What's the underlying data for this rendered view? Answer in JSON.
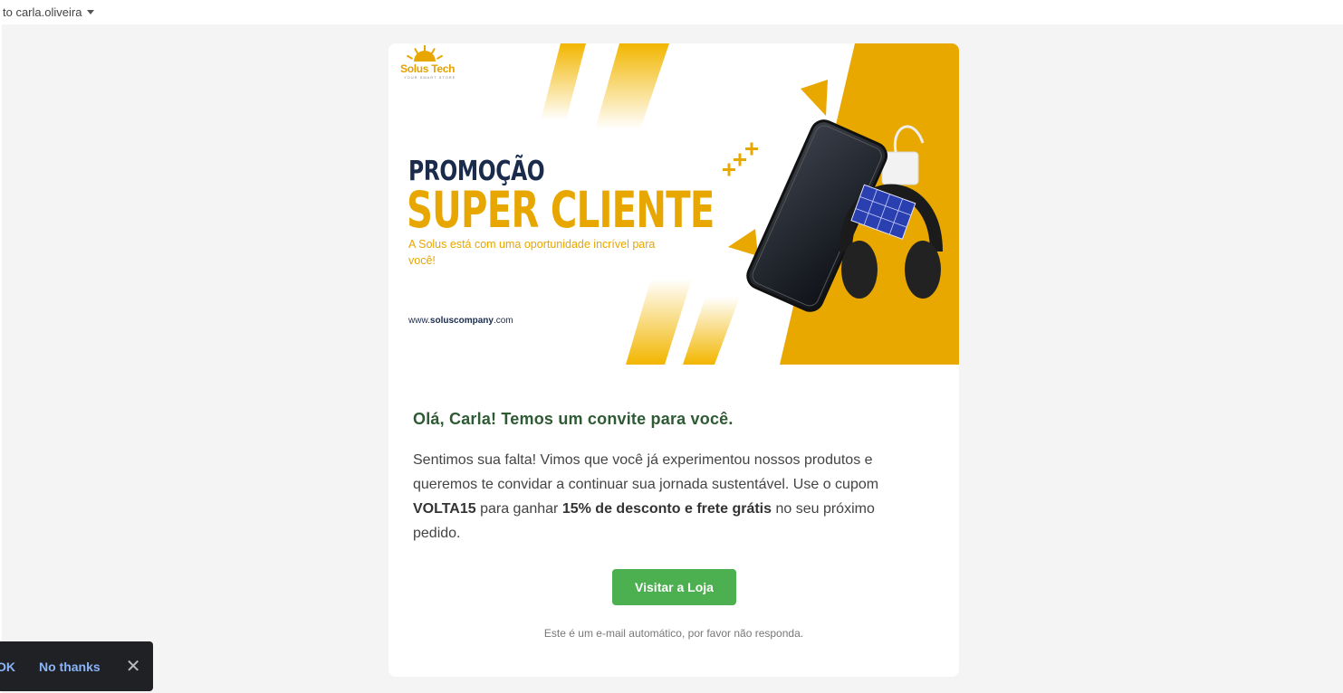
{
  "header": {
    "recipient_label": "to carla.oliveira"
  },
  "banner": {
    "logo_text": "Solus Tech",
    "logo_sub": "YOUR SMART STORE",
    "headline_1": "PROMOÇÃO",
    "headline_2": "SUPER CLIENTE",
    "subtitle": "A Solus está com uma oportunidade incrível para você!",
    "website_prefix": "www.",
    "website_bold": "soluscompany",
    "website_suffix": ".com"
  },
  "email": {
    "greeting": "Olá, Carla! Temos um convite para você.",
    "body_part1": "Sentimos sua falta! Vimos que você já experimentou nossos produtos e queremos te convidar a continuar sua jornada sustentável. Use o cupom ",
    "coupon": "VOLTA15",
    "body_part2": " para ganhar ",
    "offer": "15% de desconto e frete grátis",
    "body_part3": " no seu próximo pedido.",
    "cta_label": "Visitar a Loja",
    "footnote": "Este é um e-mail automático, por favor não responda."
  },
  "snackbar": {
    "ok_label": "OK",
    "no_thanks_label": "No thanks",
    "close_icon": "close-icon"
  },
  "colors": {
    "accent_yellow": "#e8a600",
    "navy": "#1a2b4c",
    "green_cta": "#4caf50",
    "greeting_green": "#2e5a34"
  }
}
